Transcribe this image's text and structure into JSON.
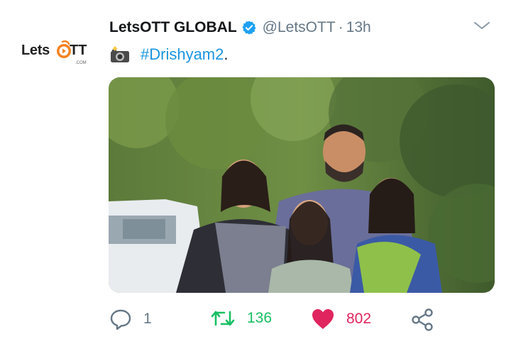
{
  "account": {
    "display_name": "LetsOTT GLOBAL",
    "handle": "@LetsOTT",
    "separator": "·",
    "time": "13h",
    "verified": true,
    "avatar_logo": {
      "text_left": "Lets",
      "text_right": "TT",
      "sub": ".COM"
    }
  },
  "tweet": {
    "emoji_icon": "camera-flash-icon",
    "hashtag": "#Drishyam2",
    "trailing": "."
  },
  "media": {
    "alt_icon": "photo"
  },
  "actions": {
    "reply_count": "1",
    "retweet_count": "136",
    "like_count": "802"
  },
  "colors": {
    "link": "#1b95e0",
    "secondary": "#657786",
    "retweet": "#17bf63",
    "like": "#e0245e",
    "logo_orange": "#f58220"
  }
}
